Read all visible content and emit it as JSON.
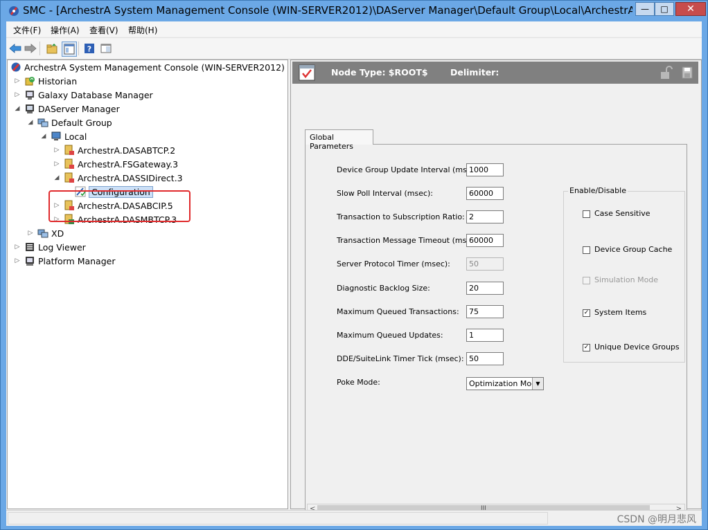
{
  "window": {
    "title": "SMC - [ArchestrA System Management Console (WIN-SERVER2012)\\DAServer Manager\\Default Group\\Local\\ArchestrA....",
    "minimize": "—",
    "restore": "□",
    "close": "✕"
  },
  "menu": [
    "文件(F)",
    "操作(A)",
    "查看(V)",
    "帮助(H)"
  ],
  "toolbar": [
    "back-icon",
    "forward-icon",
    "up-folder-icon",
    "show-tree-icon",
    "help-icon",
    "panel-icon"
  ],
  "tree": {
    "root": "ArchestrA System Management Console (WIN-SERVER2012)",
    "historian": "Historian",
    "galaxy": "Galaxy Database Manager",
    "daserver": "DAServer Manager",
    "default_group": "Default Group",
    "local": "Local",
    "dasabtcp": "ArchestrA.DASABTCP.2",
    "fsgateway": "ArchestrA.FSGateway.3",
    "dassidirect": "ArchestrA.DASSIDirect.3",
    "configuration": "Configuration",
    "dasabcip": "ArchestrA.DASABCIP.5",
    "dasmbtcp": "ArchestrA.DASMBTCP.3",
    "xd": "XD",
    "logviewer": "Log Viewer",
    "platform": "Platform Manager"
  },
  "detail": {
    "node_type": "Node Type: $ROOT$",
    "delimiter": "Delimiter:",
    "tab": "Global Parameters",
    "fields": [
      {
        "label": "Device Group Update Interval (msec):",
        "value": "1000"
      },
      {
        "label": "Slow Poll Interval (msec):",
        "value": "60000"
      },
      {
        "label": "Transaction to Subscription Ratio:",
        "value": "2"
      },
      {
        "label": "Transaction Message Timeout (msec):",
        "value": "60000"
      },
      {
        "label": "Server Protocol Timer (msec):",
        "value": "50"
      },
      {
        "label": "Diagnostic Backlog Size:",
        "value": "20"
      },
      {
        "label": "Maximum Queued Transactions:",
        "value": "75"
      },
      {
        "label": "Maximum Queued Updates:",
        "value": "1"
      },
      {
        "label": "DDE/SuiteLink Timer Tick (msec):",
        "value": "50"
      }
    ],
    "poke_label": "Poke Mode:",
    "poke_value": "Optimization Mode",
    "group_title": "Enable/Disable",
    "checks": [
      {
        "label": "Case Sensitive",
        "checked": false,
        "disabled": false
      },
      {
        "label": "Device Group Cache",
        "checked": false,
        "disabled": false
      },
      {
        "label": "Simulation Mode",
        "checked": false,
        "disabled": true
      },
      {
        "label": "System Items",
        "checked": true,
        "disabled": false
      },
      {
        "label": "Unique Device Groups",
        "checked": true,
        "disabled": false
      }
    ],
    "scroll_grip": "III"
  },
  "status": {
    "watermark": "CSDN @明月悲风"
  },
  "colors": {
    "titlebar": "#6ba8e6",
    "header": "#808080",
    "highlight": "#e0292b"
  }
}
